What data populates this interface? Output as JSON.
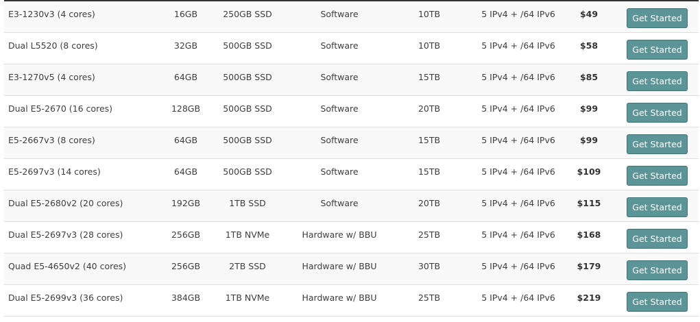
{
  "colors": {
    "button_bg": "#5b9597",
    "button_border": "#3f7274",
    "row_alt_bg": "#f9f9f9",
    "text": "#3d3d3d"
  },
  "servers": [
    {
      "cpu": "E3-1230v3 (4 cores)",
      "ram": "16GB",
      "storage": "250GB SSD",
      "raid": "Software",
      "bandwidth": "10TB",
      "ips": "5 IPv4 + /64 IPv6",
      "price": "$49",
      "button": "Get Started"
    },
    {
      "cpu": "Dual L5520 (8 cores)",
      "ram": "32GB",
      "storage": "500GB SSD",
      "raid": "Software",
      "bandwidth": "10TB",
      "ips": "5 IPv4 + /64 IPv6",
      "price": "$58",
      "button": "Get Started"
    },
    {
      "cpu": "E3-1270v5 (4 cores)",
      "ram": "64GB",
      "storage": "500GB SSD",
      "raid": "Software",
      "bandwidth": "15TB",
      "ips": "5 IPv4 + /64 IPv6",
      "price": "$85",
      "button": "Get Started"
    },
    {
      "cpu": "Dual E5-2670 (16 cores)",
      "ram": "128GB",
      "storage": "500GB SSD",
      "raid": "Software",
      "bandwidth": "20TB",
      "ips": "5 IPv4 + /64 IPv6",
      "price": "$99",
      "button": "Get Started"
    },
    {
      "cpu": "E5-2667v3 (8 cores)",
      "ram": "64GB",
      "storage": "500GB SSD",
      "raid": "Software",
      "bandwidth": "15TB",
      "ips": "5 IPv4 + /64 IPv6",
      "price": "$99",
      "button": "Get Started"
    },
    {
      "cpu": "E5-2697v3 (14 cores)",
      "ram": "64GB",
      "storage": "500GB SSD",
      "raid": "Software",
      "bandwidth": "15TB",
      "ips": "5 IPv4 + /64 IPv6",
      "price": "$109",
      "button": "Get Started"
    },
    {
      "cpu": "Dual E5-2680v2 (20 cores)",
      "ram": "192GB",
      "storage": "1TB SSD",
      "raid": "Software",
      "bandwidth": "20TB",
      "ips": "5 IPv4 + /64 IPv6",
      "price": "$115",
      "button": "Get Started"
    },
    {
      "cpu": "Dual E5-2697v3 (28 cores)",
      "ram": "256GB",
      "storage": "1TB NVMe",
      "raid": "Hardware w/ BBU",
      "bandwidth": "25TB",
      "ips": "5 IPv4 + /64 IPv6",
      "price": "$168",
      "button": "Get Started"
    },
    {
      "cpu": "Quad E5-4650v2 (40 cores)",
      "ram": "256GB",
      "storage": "2TB SSD",
      "raid": "Hardware w/ BBU",
      "bandwidth": "30TB",
      "ips": "5 IPv4 + /64 IPv6",
      "price": "$179",
      "button": "Get Started"
    },
    {
      "cpu": "Dual E5-2699v3 (36 cores)",
      "ram": "384GB",
      "storage": "1TB NVMe",
      "raid": "Hardware w/ BBU",
      "bandwidth": "25TB",
      "ips": "5 IPv4 + /64 IPv6",
      "price": "$219",
      "button": "Get Started"
    }
  ]
}
